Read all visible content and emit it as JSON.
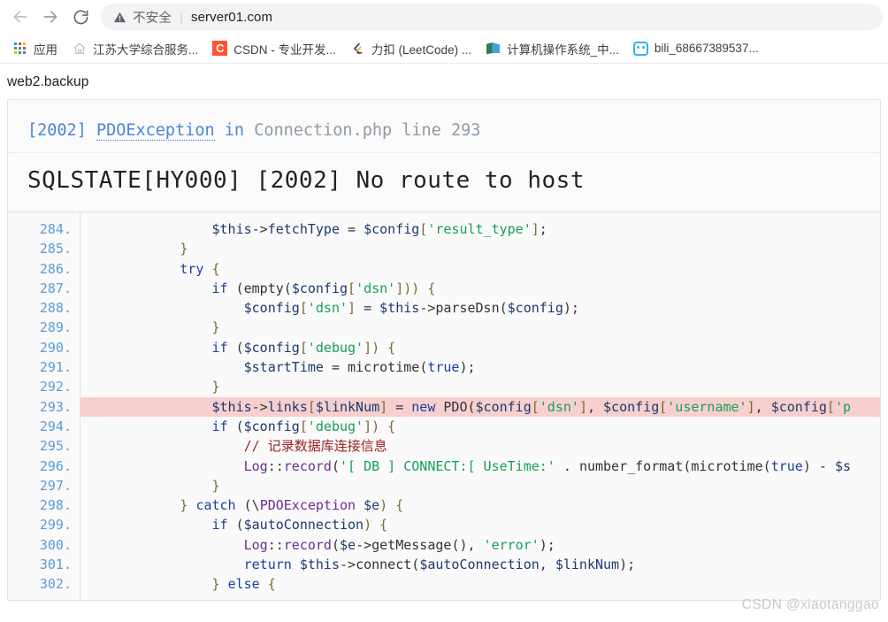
{
  "browser": {
    "nav": {
      "back_icon": "arrow-left-icon",
      "forward_icon": "arrow-right-icon",
      "reload_icon": "reload-icon"
    },
    "omnibox": {
      "warning_icon": "warning-triangle-icon",
      "security_text": "不安全",
      "separator": "|",
      "url": "server01.com"
    },
    "bookmarks": [
      {
        "icon": "apps-grid-icon",
        "label": "应用"
      },
      {
        "icon": "home-icon",
        "label": "江苏大学综合服务..."
      },
      {
        "icon": "csdn-icon",
        "label": "CSDN - 专业开发..."
      },
      {
        "icon": "leetcode-icon",
        "label": "力扣 (LeetCode) ..."
      },
      {
        "icon": "book-icon",
        "label": "计算机操作系统_中..."
      },
      {
        "icon": "bilibili-icon",
        "label": "bili_68667389537..."
      }
    ]
  },
  "page": {
    "title": "web2.backup",
    "exception": {
      "code": "[2002]",
      "type": "PDOException",
      "in_word": "in",
      "file": "Connection.php",
      "line_word": "line",
      "line_number": "293",
      "message": "SQLSTATE[HY000] [2002] No route to host"
    },
    "code_listing": {
      "highlight_line": 293,
      "colors": {
        "highlight_bg": "#f7cfcf",
        "line_number": "#5b9bd5",
        "string": "#17a05a",
        "keyword": "#1a3f9e",
        "variable": "#1b3a6b",
        "comment": "#9c2222",
        "class": "#6b2f8f",
        "bracket": "#7a6a2e"
      },
      "lines": [
        {
          "n": "284.",
          "tokens": [
            {
              "t": "                ",
              "c": "plain"
            },
            {
              "t": "$this",
              "c": "var"
            },
            {
              "t": "->",
              "c": "op"
            },
            {
              "t": "fetchType",
              "c": "var"
            },
            {
              "t": " = ",
              "c": "op"
            },
            {
              "t": "$config",
              "c": "var"
            },
            {
              "t": "[",
              "c": "punc"
            },
            {
              "t": "'result_type'",
              "c": "str"
            },
            {
              "t": "]",
              "c": "punc"
            },
            {
              "t": ";",
              "c": "op"
            }
          ]
        },
        {
          "n": "285.",
          "tokens": [
            {
              "t": "            ",
              "c": "plain"
            },
            {
              "t": "}",
              "c": "punc"
            }
          ]
        },
        {
          "n": "286.",
          "tokens": [
            {
              "t": "            ",
              "c": "plain"
            },
            {
              "t": "try",
              "c": "kw"
            },
            {
              "t": " {",
              "c": "punc"
            }
          ]
        },
        {
          "n": "287.",
          "tokens": [
            {
              "t": "                ",
              "c": "plain"
            },
            {
              "t": "if",
              "c": "kw"
            },
            {
              "t": " (",
              "c": "op"
            },
            {
              "t": "empty",
              "c": "plain"
            },
            {
              "t": "(",
              "c": "op"
            },
            {
              "t": "$config",
              "c": "var"
            },
            {
              "t": "[",
              "c": "punc"
            },
            {
              "t": "'dsn'",
              "c": "str"
            },
            {
              "t": "]",
              "c": "punc"
            },
            {
              "t": ")) {",
              "c": "punc"
            }
          ]
        },
        {
          "n": "288.",
          "tokens": [
            {
              "t": "                    ",
              "c": "plain"
            },
            {
              "t": "$config",
              "c": "var"
            },
            {
              "t": "[",
              "c": "punc"
            },
            {
              "t": "'dsn'",
              "c": "str"
            },
            {
              "t": "]",
              "c": "punc"
            },
            {
              "t": " = ",
              "c": "op"
            },
            {
              "t": "$this",
              "c": "var"
            },
            {
              "t": "->",
              "c": "op"
            },
            {
              "t": "parseDsn",
              "c": "plain"
            },
            {
              "t": "(",
              "c": "op"
            },
            {
              "t": "$config",
              "c": "var"
            },
            {
              "t": ");",
              "c": "op"
            }
          ]
        },
        {
          "n": "289.",
          "tokens": [
            {
              "t": "                ",
              "c": "plain"
            },
            {
              "t": "}",
              "c": "punc"
            }
          ]
        },
        {
          "n": "290.",
          "tokens": [
            {
              "t": "                ",
              "c": "plain"
            },
            {
              "t": "if",
              "c": "kw"
            },
            {
              "t": " (",
              "c": "op"
            },
            {
              "t": "$config",
              "c": "var"
            },
            {
              "t": "[",
              "c": "punc"
            },
            {
              "t": "'debug'",
              "c": "str"
            },
            {
              "t": "]",
              "c": "punc"
            },
            {
              "t": ") {",
              "c": "punc"
            }
          ]
        },
        {
          "n": "291.",
          "tokens": [
            {
              "t": "                    ",
              "c": "plain"
            },
            {
              "t": "$startTime",
              "c": "var"
            },
            {
              "t": " = ",
              "c": "op"
            },
            {
              "t": "microtime",
              "c": "plain"
            },
            {
              "t": "(",
              "c": "op"
            },
            {
              "t": "true",
              "c": "kw"
            },
            {
              "t": ");",
              "c": "op"
            }
          ]
        },
        {
          "n": "292.",
          "tokens": [
            {
              "t": "                ",
              "c": "plain"
            },
            {
              "t": "}",
              "c": "punc"
            }
          ]
        },
        {
          "n": "293.",
          "hl": true,
          "tokens": [
            {
              "t": "                ",
              "c": "plain"
            },
            {
              "t": "$this",
              "c": "var"
            },
            {
              "t": "->",
              "c": "op"
            },
            {
              "t": "links",
              "c": "var"
            },
            {
              "t": "[",
              "c": "punc"
            },
            {
              "t": "$linkNum",
              "c": "var"
            },
            {
              "t": "]",
              "c": "punc"
            },
            {
              "t": " = ",
              "c": "op"
            },
            {
              "t": "new",
              "c": "kw"
            },
            {
              "t": " PDO",
              "c": "plain"
            },
            {
              "t": "(",
              "c": "op"
            },
            {
              "t": "$config",
              "c": "var"
            },
            {
              "t": "[",
              "c": "punc"
            },
            {
              "t": "'dsn'",
              "c": "str"
            },
            {
              "t": "]",
              "c": "punc"
            },
            {
              "t": ", ",
              "c": "op"
            },
            {
              "t": "$config",
              "c": "var"
            },
            {
              "t": "[",
              "c": "punc"
            },
            {
              "t": "'username'",
              "c": "str"
            },
            {
              "t": "]",
              "c": "punc"
            },
            {
              "t": ", ",
              "c": "op"
            },
            {
              "t": "$config",
              "c": "var"
            },
            {
              "t": "[",
              "c": "punc"
            },
            {
              "t": "'p",
              "c": "str"
            }
          ]
        },
        {
          "n": "294.",
          "tokens": [
            {
              "t": "                ",
              "c": "plain"
            },
            {
              "t": "if",
              "c": "kw"
            },
            {
              "t": " (",
              "c": "op"
            },
            {
              "t": "$config",
              "c": "var"
            },
            {
              "t": "[",
              "c": "punc"
            },
            {
              "t": "'debug'",
              "c": "str"
            },
            {
              "t": "]",
              "c": "punc"
            },
            {
              "t": ") {",
              "c": "punc"
            }
          ]
        },
        {
          "n": "295.",
          "tokens": [
            {
              "t": "                    ",
              "c": "plain"
            },
            {
              "t": "// 记录数据库连接信息",
              "c": "cmt"
            }
          ]
        },
        {
          "n": "296.",
          "tokens": [
            {
              "t": "                    ",
              "c": "plain"
            },
            {
              "t": "Log",
              "c": "cls"
            },
            {
              "t": "::",
              "c": "op"
            },
            {
              "t": "record",
              "c": "cls"
            },
            {
              "t": "(",
              "c": "op"
            },
            {
              "t": "'[ DB ] CONNECT:[ UseTime:'",
              "c": "str"
            },
            {
              "t": " . ",
              "c": "op"
            },
            {
              "t": "number_format",
              "c": "plain"
            },
            {
              "t": "(",
              "c": "op"
            },
            {
              "t": "microtime",
              "c": "plain"
            },
            {
              "t": "(",
              "c": "op"
            },
            {
              "t": "true",
              "c": "kw"
            },
            {
              "t": ")",
              "c": "op"
            },
            {
              "t": " - ",
              "c": "op"
            },
            {
              "t": "$s",
              "c": "var"
            }
          ]
        },
        {
          "n": "297.",
          "tokens": [
            {
              "t": "                ",
              "c": "plain"
            },
            {
              "t": "}",
              "c": "punc"
            }
          ]
        },
        {
          "n": "298.",
          "tokens": [
            {
              "t": "            ",
              "c": "plain"
            },
            {
              "t": "} ",
              "c": "punc"
            },
            {
              "t": "catch",
              "c": "kw"
            },
            {
              "t": " (\\",
              "c": "op"
            },
            {
              "t": "PDOException",
              "c": "cls"
            },
            {
              "t": " ",
              "c": "op"
            },
            {
              "t": "$e",
              "c": "var"
            },
            {
              "t": ") {",
              "c": "punc"
            }
          ]
        },
        {
          "n": "299.",
          "tokens": [
            {
              "t": "                ",
              "c": "plain"
            },
            {
              "t": "if",
              "c": "kw"
            },
            {
              "t": " (",
              "c": "op"
            },
            {
              "t": "$autoConnection",
              "c": "var"
            },
            {
              "t": ") {",
              "c": "punc"
            }
          ]
        },
        {
          "n": "300.",
          "tokens": [
            {
              "t": "                    ",
              "c": "plain"
            },
            {
              "t": "Log",
              "c": "cls"
            },
            {
              "t": "::",
              "c": "op"
            },
            {
              "t": "record",
              "c": "cls"
            },
            {
              "t": "(",
              "c": "op"
            },
            {
              "t": "$e",
              "c": "var"
            },
            {
              "t": "->",
              "c": "op"
            },
            {
              "t": "getMessage",
              "c": "plain"
            },
            {
              "t": "(), ",
              "c": "op"
            },
            {
              "t": "'error'",
              "c": "str"
            },
            {
              "t": ");",
              "c": "op"
            }
          ]
        },
        {
          "n": "301.",
          "tokens": [
            {
              "t": "                    ",
              "c": "plain"
            },
            {
              "t": "return",
              "c": "kw"
            },
            {
              "t": " ",
              "c": "op"
            },
            {
              "t": "$this",
              "c": "var"
            },
            {
              "t": "->",
              "c": "op"
            },
            {
              "t": "connect",
              "c": "plain"
            },
            {
              "t": "(",
              "c": "op"
            },
            {
              "t": "$autoConnection",
              "c": "var"
            },
            {
              "t": ", ",
              "c": "op"
            },
            {
              "t": "$linkNum",
              "c": "var"
            },
            {
              "t": ");",
              "c": "op"
            }
          ]
        },
        {
          "n": "302.",
          "tokens": [
            {
              "t": "                ",
              "c": "plain"
            },
            {
              "t": "} ",
              "c": "punc"
            },
            {
              "t": "else",
              "c": "kw"
            },
            {
              "t": " {",
              "c": "punc"
            }
          ]
        }
      ]
    }
  },
  "watermark": "CSDN @xiaotanggao"
}
